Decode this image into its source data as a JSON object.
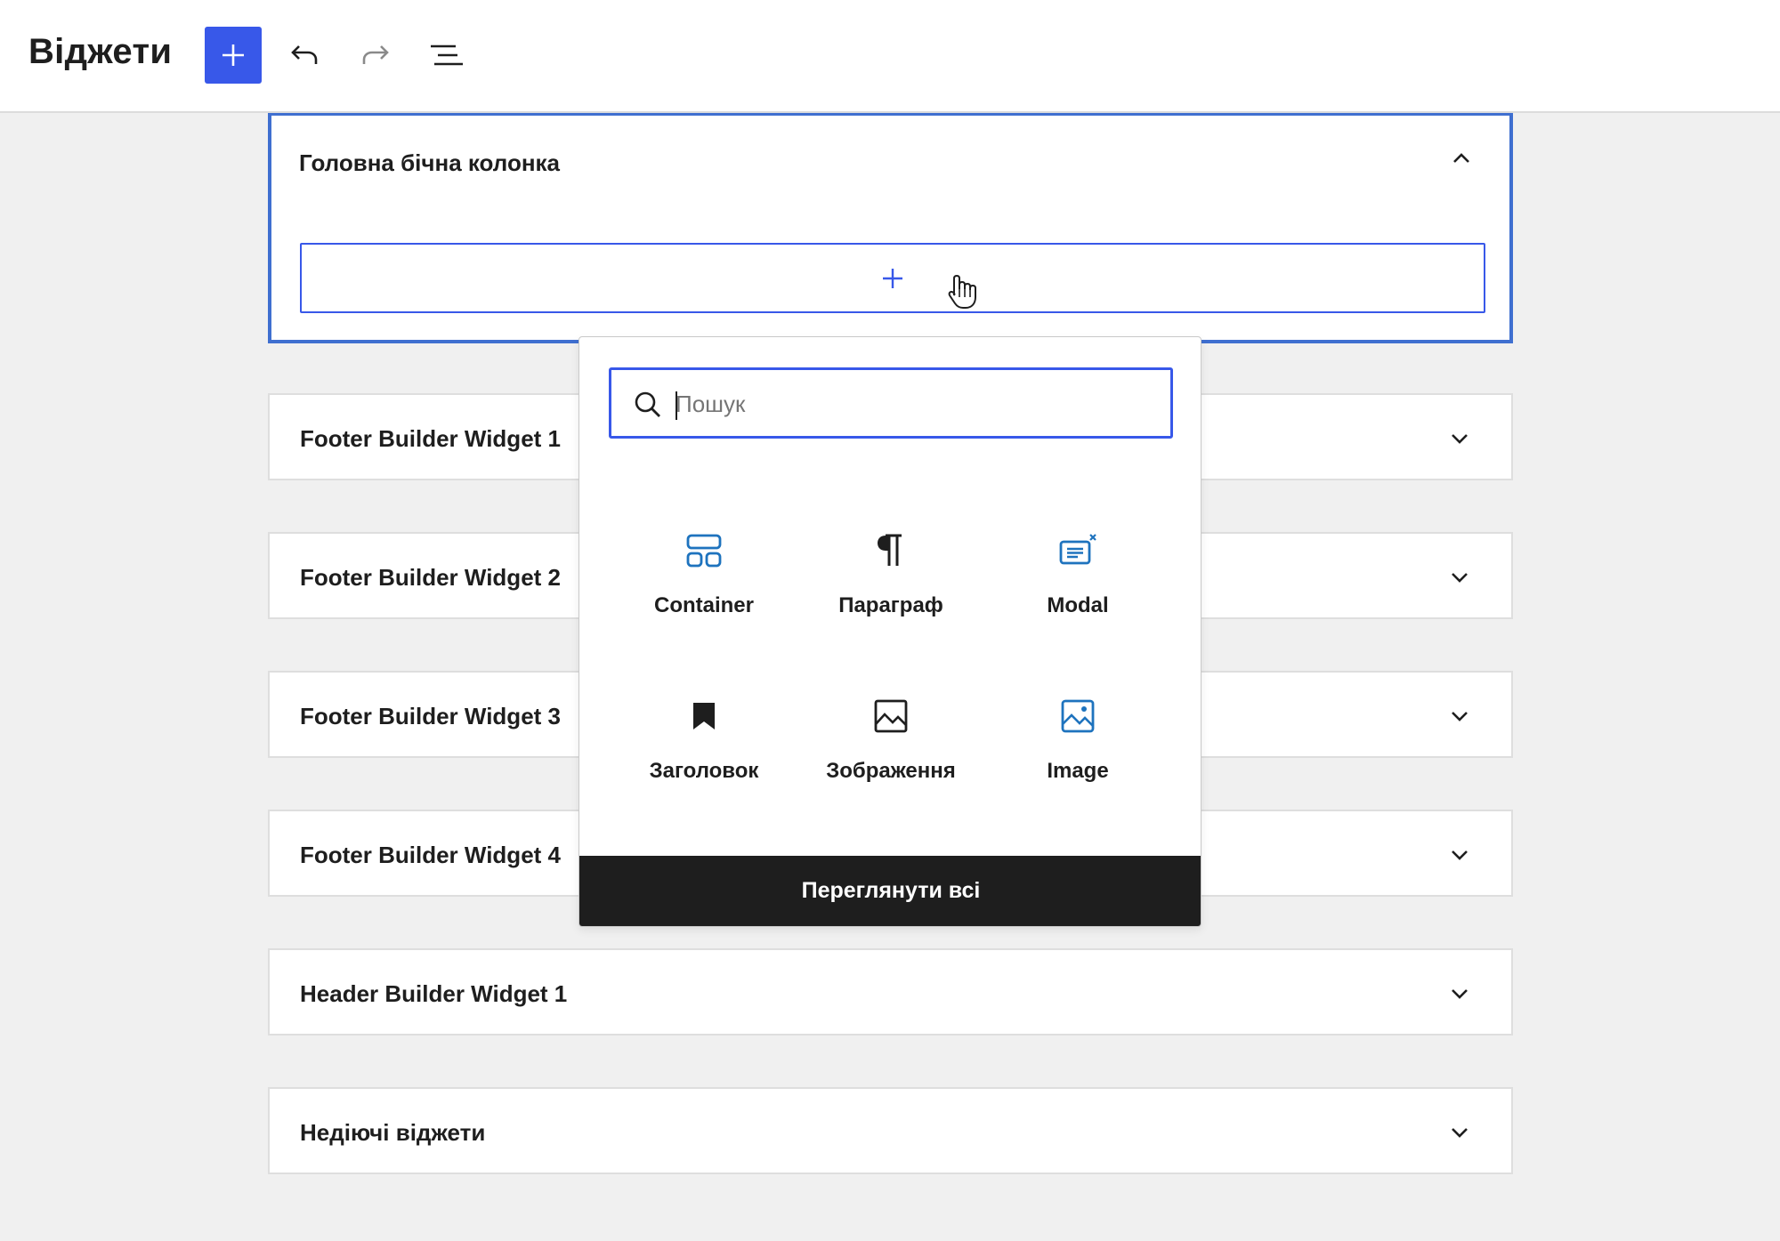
{
  "app": {
    "title": "Віджети",
    "toolbar": {
      "add_icon": "plus-icon",
      "undo_icon": "undo-icon",
      "redo_icon": "redo-icon",
      "list_view_icon": "list-view-icon"
    }
  },
  "widget_areas": [
    {
      "title": "Головна бічна колонка",
      "expanded": true
    },
    {
      "title": "Footer Builder Widget 1",
      "expanded": false
    },
    {
      "title": "Footer Builder Widget 2",
      "expanded": false
    },
    {
      "title": "Footer Builder Widget 3",
      "expanded": false
    },
    {
      "title": "Footer Builder Widget 4",
      "expanded": false
    },
    {
      "title": "Header Builder Widget 1",
      "expanded": false
    },
    {
      "title": "Недіючі віджети",
      "expanded": false
    }
  ],
  "inserter": {
    "search_placeholder": "Пошук",
    "search_value": "",
    "blocks": [
      {
        "label": "Container",
        "icon": "container-icon"
      },
      {
        "label": "Параграф",
        "icon": "paragraph-icon"
      },
      {
        "label": "Modal",
        "icon": "modal-icon"
      },
      {
        "label": "Заголовок",
        "icon": "heading-bookmark-icon"
      },
      {
        "label": "Зображення",
        "icon": "image-icon"
      },
      {
        "label": "Image",
        "icon": "image-icon"
      }
    ],
    "browse_all_label": "Переглянути всі"
  },
  "colors": {
    "accent": "#3858e9",
    "block_icon_blue": "#1e73be",
    "dark": "#1e1e1e",
    "background": "#f0f0f0"
  }
}
